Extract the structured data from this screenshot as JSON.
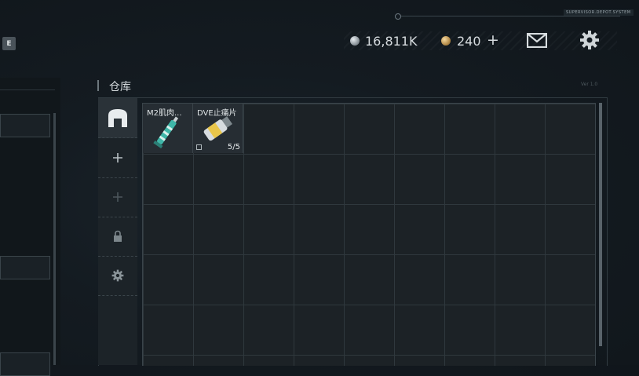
{
  "hud": {
    "server_tag": "SUPERVISOR.DEPOT.SYSTEM"
  },
  "key_hint": {
    "label": "E"
  },
  "currency": {
    "silver": "16,811K",
    "gold": "240",
    "gold_add": "+"
  },
  "warehouse": {
    "title": "仓库",
    "corner_tag": "Ver 1.0",
    "tabs": [
      {
        "icon": "storage-icon"
      },
      {
        "icon": "plus-icon"
      },
      {
        "icon": "plus-icon"
      },
      {
        "icon": "lock-icon"
      },
      {
        "icon": "gear-icon"
      }
    ],
    "items": [
      {
        "label": "M2肌肉...",
        "icon": "syringe-icon"
      },
      {
        "label": "DVE止痛片",
        "icon": "pill-bottle-icon",
        "count": "5/5"
      }
    ]
  },
  "colors": {
    "bg": "#141b21",
    "accent": "#2a3238",
    "text": "#d7dcdf"
  }
}
